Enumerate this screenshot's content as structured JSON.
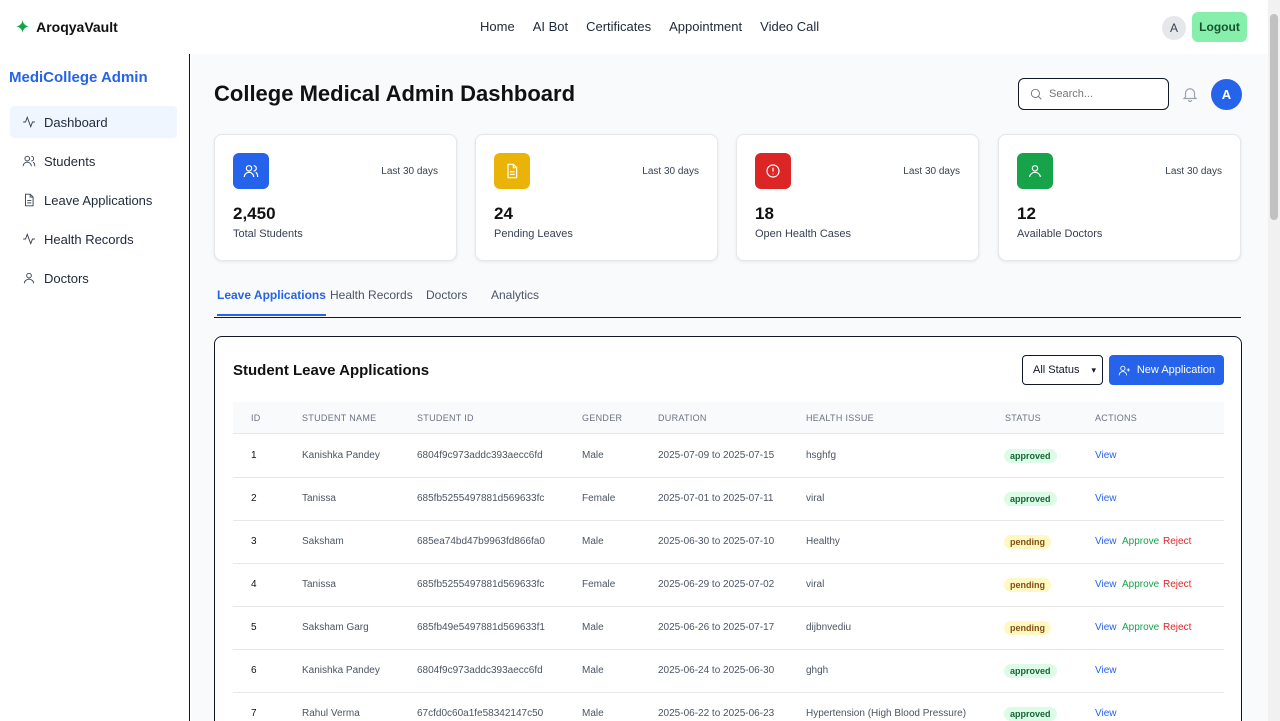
{
  "topbar": {
    "brand": "AroqyaVault",
    "nav": [
      "Home",
      "AI Bot",
      "Certificates",
      "Appointment",
      "Video Call"
    ],
    "avatar": "A",
    "logout": "Logout"
  },
  "sidebar": {
    "title": "MediCollege Admin",
    "items": [
      {
        "label": "Dashboard",
        "icon": "activity-icon",
        "active": true
      },
      {
        "label": "Students",
        "icon": "users-icon",
        "active": false
      },
      {
        "label": "Leave Applications",
        "icon": "file-icon",
        "active": false
      },
      {
        "label": "Health Records",
        "icon": "activity-icon",
        "active": false
      },
      {
        "label": "Doctors",
        "icon": "user-icon",
        "active": false
      }
    ]
  },
  "main": {
    "title": "College Medical Admin Dashboard",
    "search_placeholder": "Search...",
    "avatar": "A",
    "stats": [
      {
        "value": "2,450",
        "label": "Total Students",
        "period": "Last 30 days",
        "color": "#2563eb",
        "icon": "users-icon"
      },
      {
        "value": "24",
        "label": "Pending Leaves",
        "period": "Last 30 days",
        "color": "#eab308",
        "icon": "file-icon"
      },
      {
        "value": "18",
        "label": "Open Health Cases",
        "period": "Last 30 days",
        "color": "#dc2626",
        "icon": "alert-circle-icon"
      },
      {
        "value": "12",
        "label": "Available Doctors",
        "period": "Last 30 days",
        "color": "#16a34a",
        "icon": "user-icon"
      }
    ],
    "tabs": [
      "Leave Applications",
      "Health Records",
      "Doctors",
      "Analytics"
    ],
    "table": {
      "title": "Student Leave Applications",
      "filter": "All Status",
      "new_button": "New Application",
      "columns": [
        "ID",
        "Student Name",
        "Student ID",
        "Gender",
        "Duration",
        "Health Issue",
        "Status",
        "Actions"
      ],
      "rows": [
        {
          "id": "1",
          "name": "Kanishka Pandey",
          "sid": "6804f9c973addc393aecc6fd",
          "gender": "Male",
          "duration": "2025-07-09 to 2025-07-15",
          "issue": "hsghfg",
          "status": "approved"
        },
        {
          "id": "2",
          "name": "Tanissa",
          "sid": "685fb5255497881d569633fc",
          "gender": "Female",
          "duration": "2025-07-01 to 2025-07-11",
          "issue": "viral",
          "status": "approved"
        },
        {
          "id": "3",
          "name": "Saksham",
          "sid": "685ea74bd47b9963fd866fa0",
          "gender": "Male",
          "duration": "2025-06-30 to 2025-07-10",
          "issue": "Healthy",
          "status": "pending"
        },
        {
          "id": "4",
          "name": "Tanissa",
          "sid": "685fb5255497881d569633fc",
          "gender": "Female",
          "duration": "2025-06-29 to 2025-07-02",
          "issue": "viral",
          "status": "pending"
        },
        {
          "id": "5",
          "name": "Saksham Garg",
          "sid": "685fb49e5497881d569633f1",
          "gender": "Male",
          "duration": "2025-06-26 to 2025-07-17",
          "issue": "dijbnvediu",
          "status": "pending"
        },
        {
          "id": "6",
          "name": "Kanishka Pandey",
          "sid": "6804f9c973addc393aecc6fd",
          "gender": "Male",
          "duration": "2025-06-24 to 2025-06-30",
          "issue": "ghgh",
          "status": "approved"
        },
        {
          "id": "7",
          "name": "Rahul Verma",
          "sid": "67cfd0c60a1fe58342147c50",
          "gender": "Male",
          "duration": "2025-06-22 to 2025-06-23",
          "issue": "Hypertension (High Blood Pressure)",
          "status": "approved"
        }
      ],
      "actions": {
        "view": "View",
        "approve": "Approve",
        "reject": "Reject"
      }
    }
  }
}
